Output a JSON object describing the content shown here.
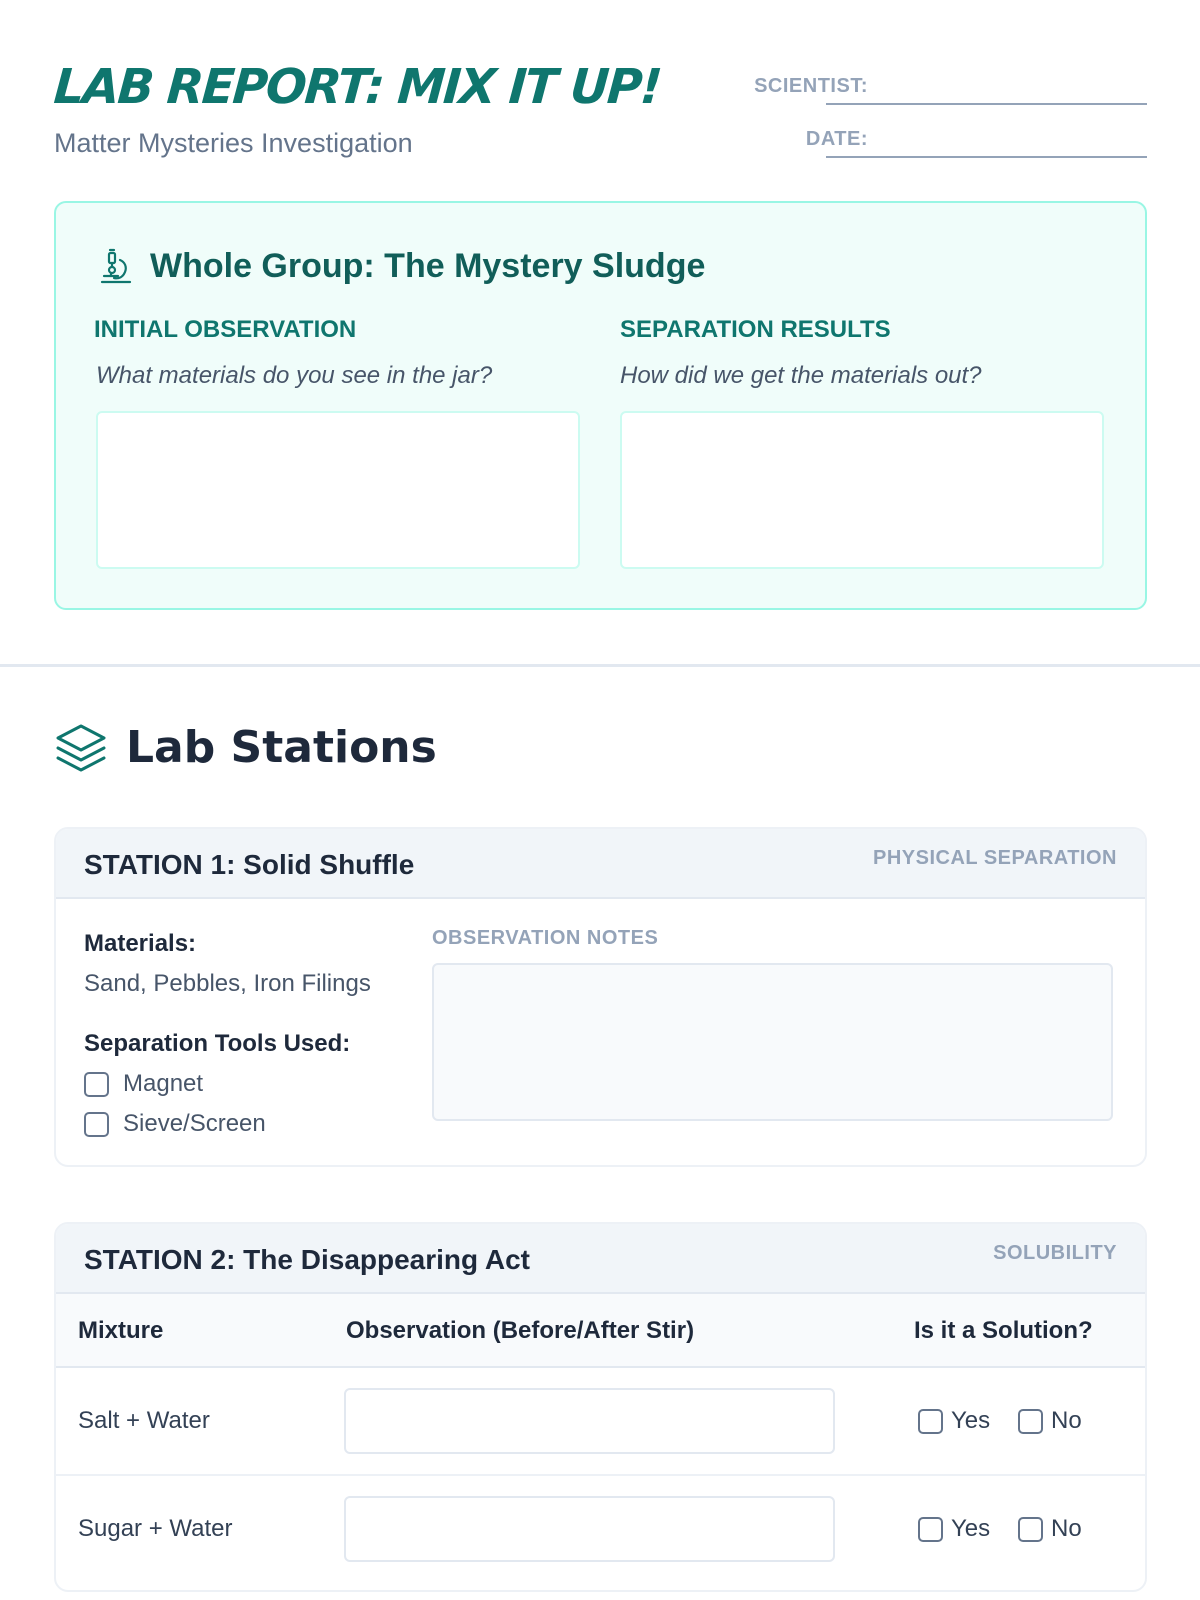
{
  "header": {
    "title": "LAB REPORT: MIX IT UP!",
    "subtitle": "Matter Mysteries Investigation",
    "scientist_label": "SCIENTIST:",
    "date_label": "DATE:"
  },
  "whole_group": {
    "icon": "microscope-icon",
    "title": "Whole Group: The Mystery Sludge",
    "left": {
      "heading": "INITIAL OBSERVATION",
      "question": "What materials do you see in the jar?"
    },
    "right": {
      "heading": "SEPARATION RESULTS",
      "question": "How did we get the materials out?"
    }
  },
  "stations_section": {
    "icon": "layers-icon",
    "title": "Lab Stations"
  },
  "station1": {
    "title": "STATION 1: Solid Shuffle",
    "tag": "PHYSICAL SEPARATION",
    "materials_label": "Materials:",
    "materials": "Sand, Pebbles, Iron Filings",
    "tools_label": "Separation Tools Used:",
    "tools": [
      "Magnet",
      "Sieve/Screen"
    ],
    "notes_label": "OBSERVATION NOTES"
  },
  "station2": {
    "title": "STATION 2: The Disappearing Act",
    "tag": "SOLUBILITY",
    "columns": [
      "Mixture",
      "Observation (Before/After Stir)",
      "Is it a Solution?"
    ],
    "rows": [
      {
        "mixture": "Salt + Water",
        "yes": "Yes",
        "no": "No"
      },
      {
        "mixture": "Sugar + Water",
        "yes": "Yes",
        "no": "No"
      }
    ]
  },
  "colors": {
    "accent": "#0f766e",
    "accent_light": "#f0fdfa",
    "border_teal": "#99f6e4",
    "muted": "#94a3b8"
  }
}
